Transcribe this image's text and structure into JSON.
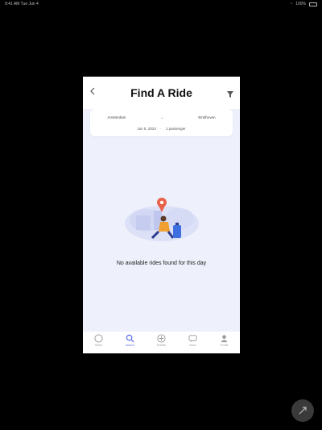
{
  "status_bar": {
    "time": "9:41 AM",
    "date": "Tue Jun 4",
    "battery": "100%"
  },
  "header": {
    "title": "Find A Ride",
    "back_icon": "chevron-left-icon",
    "filter_icon": "filter-icon"
  },
  "search": {
    "from": "Amsterdam",
    "arrow": "→",
    "to": "Eindhoven",
    "date": "Jun 5, 2024",
    "passengers": "1 passenger"
  },
  "empty_state": {
    "message": "No available rides found for this day"
  },
  "tabs": [
    {
      "label": "Home",
      "icon": "home-icon",
      "active": false
    },
    {
      "label": "Search",
      "icon": "search-icon",
      "active": true
    },
    {
      "label": "Publish",
      "icon": "plus-icon",
      "active": false
    },
    {
      "label": "Inbox",
      "icon": "chat-icon",
      "active": false
    },
    {
      "label": "Profile",
      "icon": "user-icon",
      "active": false
    }
  ],
  "colors": {
    "background": "#000000",
    "app_bg": "#eef0fb",
    "accent": "#5a6cf0",
    "pin": "#e8604a",
    "person_accent": "#f0a030"
  }
}
